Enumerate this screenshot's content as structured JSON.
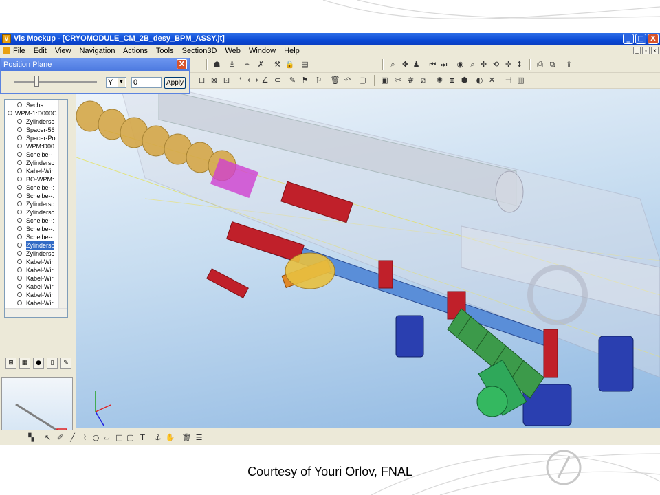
{
  "window": {
    "title": "Vis Mockup - [CRYOMODULE_CM_2B_desy_BPM_ASSY.jt]",
    "minimize": "_",
    "maximize": "□",
    "close": "X"
  },
  "menu": [
    "File",
    "Edit",
    "View",
    "Navigation",
    "Actions",
    "Tools",
    "Section3D",
    "Web",
    "Window",
    "Help"
  ],
  "position_plane": {
    "title": "Position Plane",
    "close": "X",
    "axis_value": "Y",
    "offset_value": "0",
    "apply_label": "Apply"
  },
  "tree": {
    "items": [
      {
        "label": "Sechs",
        "indent": 2
      },
      {
        "label": "WPM-1:D000C",
        "indent": 1
      },
      {
        "label": "Zylindersc",
        "indent": 2
      },
      {
        "label": "Spacer-56",
        "indent": 2
      },
      {
        "label": "Spacer-Po",
        "indent": 2
      },
      {
        "label": "WPM:D00",
        "indent": 2
      },
      {
        "label": "Scheibe--",
        "indent": 2
      },
      {
        "label": "Zylindersc",
        "indent": 2
      },
      {
        "label": "Kabel-Wir",
        "indent": 2
      },
      {
        "label": "BO-WPM:",
        "indent": 2
      },
      {
        "label": "Scheibe--:",
        "indent": 2
      },
      {
        "label": "Scheibe--:",
        "indent": 2
      },
      {
        "label": "Zylindersc",
        "indent": 2
      },
      {
        "label": "Zylindersc",
        "indent": 2
      },
      {
        "label": "Scheibe--:",
        "indent": 2
      },
      {
        "label": "Scheibe--:",
        "indent": 2
      },
      {
        "label": "Scheibe--:",
        "indent": 2
      },
      {
        "label": "Zylindersc",
        "indent": 2,
        "selected": true
      },
      {
        "label": "Zylindersc",
        "indent": 2
      },
      {
        "label": "Kabel-Wir",
        "indent": 2
      },
      {
        "label": "Kabel-Wir",
        "indent": 2
      },
      {
        "label": "Kabel-Wir",
        "indent": 2
      },
      {
        "label": "Kabel-Wir",
        "indent": 2
      },
      {
        "label": "Kabel-Wir",
        "indent": 2
      },
      {
        "label": "Kabel-Wir",
        "indent": 2
      },
      {
        "label": "Kabel-Wir",
        "indent": 2
      }
    ]
  },
  "caption": "Courtesy of Youri Orlov, FNAL",
  "colors": {
    "titlebar": "#0a48d4",
    "selection": "#316ac5",
    "section_red": "#c0202a",
    "flange_blue": "#2a3fb0",
    "bellows_green": "#3c9a4a",
    "cavity_gold": "#d6a848"
  }
}
